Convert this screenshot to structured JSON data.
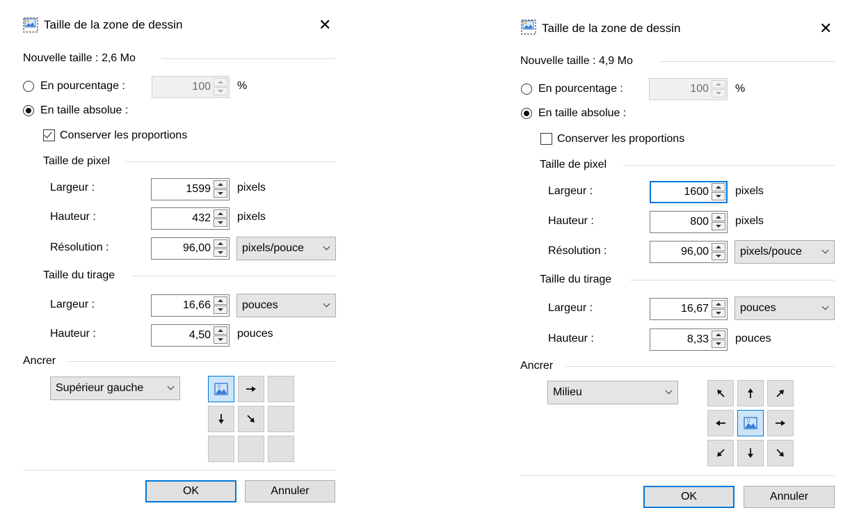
{
  "dialogs": [
    {
      "title": "Taille de la zone de dessin",
      "new_size_label": "Nouvelle taille : 2,6 Mo",
      "percent_radio_label": "En pourcentage :",
      "percent_value": "100",
      "percent_unit": "%",
      "absolute_radio_label": "En taille absolue :",
      "selected_mode": "absolute",
      "keep_ratio_label": "Conserver les proportions",
      "keep_ratio_checked": true,
      "pixel_size_label": "Taille de pixel",
      "px_width_label": "Largeur :",
      "px_width_value": "1599",
      "px_width_unit": "pixels",
      "px_height_label": "Hauteur :",
      "px_height_value": "432",
      "px_height_unit": "pixels",
      "resolution_label": "Résolution :",
      "resolution_value": "96,00",
      "resolution_unit": "pixels/pouce",
      "print_size_label": "Taille du tirage",
      "print_width_label": "Largeur :",
      "print_width_value": "16,66",
      "print_width_unit": "pouces",
      "print_height_label": "Hauteur :",
      "print_height_value": "4,50",
      "print_height_unit": "pouces",
      "anchor_label": "Ancrer",
      "anchor_value": "Supérieur gauche",
      "anchor_grid": [
        "image",
        "arrow-right",
        "",
        "arrow-down",
        "arrow-down-right",
        "",
        "",
        "",
        ""
      ],
      "ok_label": "OK",
      "cancel_label": "Annuler",
      "focused_field": "none"
    },
    {
      "title": "Taille de la zone de dessin",
      "new_size_label": "Nouvelle taille : 4,9 Mo",
      "percent_radio_label": "En pourcentage :",
      "percent_value": "100",
      "percent_unit": "%",
      "absolute_radio_label": "En taille absolue :",
      "selected_mode": "absolute",
      "keep_ratio_label": "Conserver les proportions",
      "keep_ratio_checked": false,
      "pixel_size_label": "Taille de pixel",
      "px_width_label": "Largeur :",
      "px_width_value": "1600",
      "px_width_unit": "pixels",
      "px_height_label": "Hauteur :",
      "px_height_value": "800",
      "px_height_unit": "pixels",
      "resolution_label": "Résolution :",
      "resolution_value": "96,00",
      "resolution_unit": "pixels/pouce",
      "print_size_label": "Taille du tirage",
      "print_width_label": "Largeur :",
      "print_width_value": "16,67",
      "print_width_unit": "pouces",
      "print_height_label": "Hauteur :",
      "print_height_value": "8,33",
      "print_height_unit": "pouces",
      "anchor_label": "Ancrer",
      "anchor_value": "Milieu",
      "anchor_grid": [
        "arrow-up-left",
        "arrow-up",
        "arrow-up-right",
        "arrow-left",
        "image",
        "arrow-right",
        "arrow-down-left",
        "arrow-down",
        "arrow-down-right"
      ],
      "ok_label": "OK",
      "cancel_label": "Annuler",
      "focused_field": "px_width"
    }
  ],
  "colors": {
    "accent": "#0078d7",
    "button_face": "#e1e1e1",
    "separator": "#dadada",
    "anchor_selected": "#cce4f7"
  }
}
